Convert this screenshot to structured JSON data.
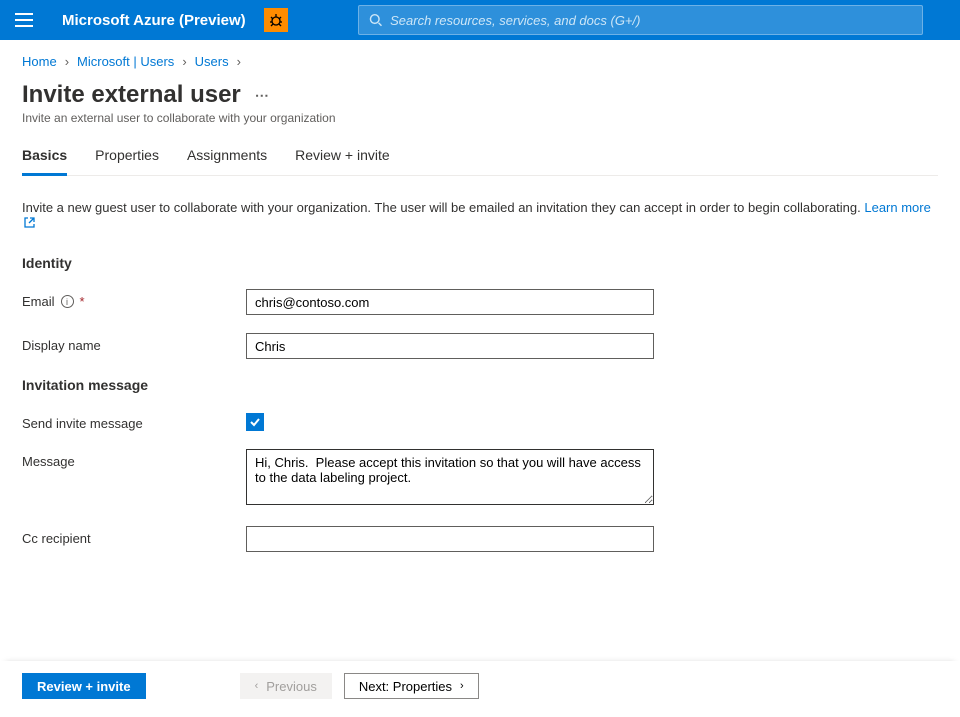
{
  "brand": "Microsoft Azure (Preview)",
  "search": {
    "placeholder": "Search resources, services, and docs (G+/)"
  },
  "breadcrumbs": {
    "home": "Home",
    "mid": "Microsoft | Users",
    "last": "Users"
  },
  "page": {
    "title": "Invite external user",
    "subtitle": "Invite an external user to collaborate with your organization"
  },
  "tabs": {
    "basics": "Basics",
    "properties": "Properties",
    "assignments": "Assignments",
    "review": "Review + invite"
  },
  "intro": {
    "text": "Invite a new guest user to collaborate with your organization. The user will be emailed an invitation they can accept in order to begin collaborating. ",
    "learn": "Learn more"
  },
  "sections": {
    "identity": "Identity",
    "invitation": "Invitation message"
  },
  "fields": {
    "email_label": "Email",
    "email_value": "chris@contoso.com",
    "display_label": "Display name",
    "display_value": "Chris",
    "send_label": "Send invite message",
    "message_label": "Message",
    "message_value": "Hi, Chris.  Please accept this invitation so that you will have access to the data labeling project.",
    "cc_label": "Cc recipient",
    "cc_value": ""
  },
  "footer": {
    "review": "Review + invite",
    "previous": "Previous",
    "next": "Next: Properties"
  }
}
